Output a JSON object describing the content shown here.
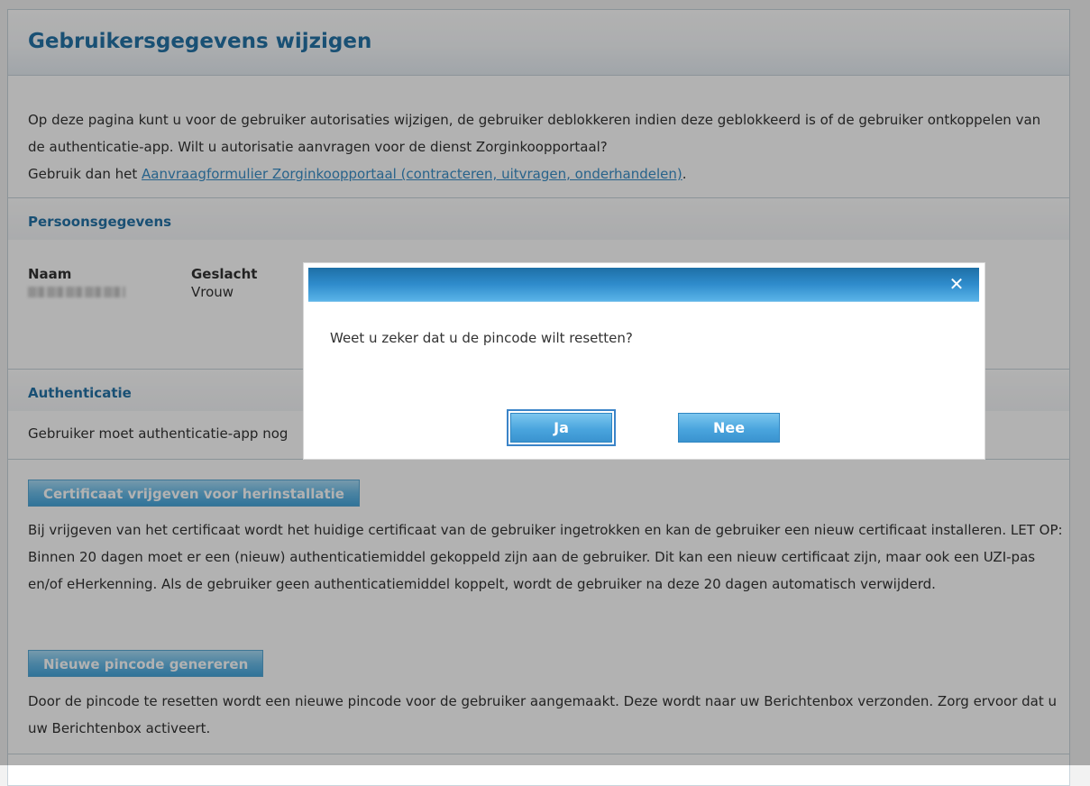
{
  "page": {
    "title": "Gebruikersgegevens wijzigen",
    "intro_line1": "Op deze pagina kunt u voor de gebruiker autorisaties wijzigen, de gebruiker deblokkeren indien deze geblokkeerd is of de gebruiker ontkoppelen van de authenticatie-app. Wilt u autorisatie aanvragen voor de dienst Zorginkoopportaal?",
    "intro_prefix": "Gebruik dan het ",
    "intro_link": "Aanvraagformulier Zorginkoopportaal (contracteren, uitvragen, onderhandelen)",
    "intro_suffix": "."
  },
  "persoonsgegevens": {
    "heading": "Persoonsgegevens",
    "naam_label": "Naam",
    "geslacht_label": "Geslacht",
    "geslacht_value": "Vrouw"
  },
  "authenticatie": {
    "heading": "Authenticatie",
    "status_text": "Gebruiker moet authenticatie-app nog",
    "certificate_button": "Certificaat vrijgeven voor herinstallatie",
    "certificate_text": "Bij vrijgeven van het certificaat wordt het huidige certificaat van de gebruiker ingetrokken en kan de gebruiker een nieuw certificaat installeren. LET OP: Binnen 20 dagen moet er een (nieuw) authenticatiemiddel gekoppeld zijn aan de gebruiker. Dit kan een nieuw certificaat zijn, maar ook een UZI-pas en/of eHerkenning. Als de gebruiker geen authenticatiemiddel koppelt, wordt de gebruiker na deze 20 dagen automatisch verwijderd.",
    "pincode_button": "Nieuwe pincode genereren",
    "pincode_text": "Door de pincode te resetten wordt een nieuwe pincode voor de gebruiker aangemaakt. Deze wordt naar uw Berichtenbox verzonden. Zorg ervoor dat u uw Berichtenbox activeert."
  },
  "dialog": {
    "message": "Weet u zeker dat u de pincode wilt resetten?",
    "yes_label": "Ja",
    "no_label": "Nee",
    "close_icon": "close-icon"
  },
  "colors": {
    "heading_blue": "#2473a6",
    "button_blue": "#46a6dc",
    "dialog_bar": "#2f8ccc"
  }
}
